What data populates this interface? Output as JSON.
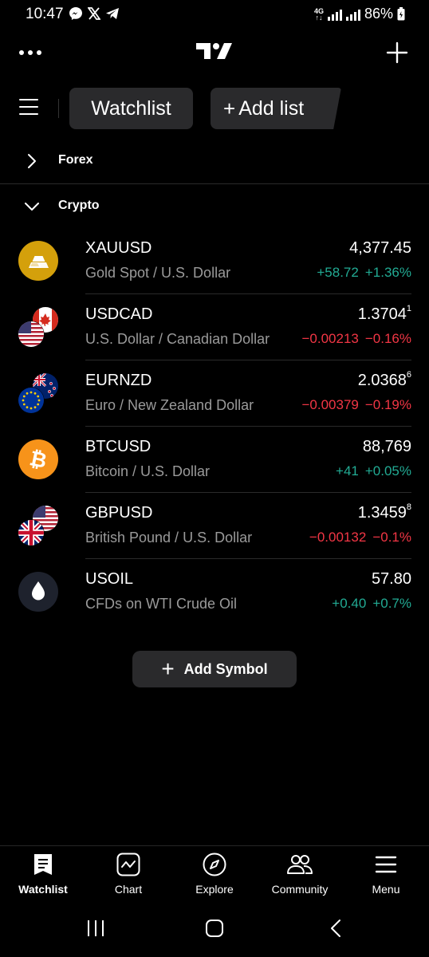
{
  "status_bar": {
    "time": "10:47",
    "network": "4G",
    "battery": "86%"
  },
  "tabs": {
    "watchlist": "Watchlist",
    "add_list": "Add list"
  },
  "sections": {
    "forex": "Forex",
    "crypto": "Crypto"
  },
  "symbols": [
    {
      "ticker": "XAUUSD",
      "name": "Gold Spot / U.S. Dollar",
      "price": "4,377.45",
      "price_sup": "",
      "change": "+58.72",
      "change_pct": "+1.36%",
      "direction": "up",
      "icon": "gold-bars-icon"
    },
    {
      "ticker": "USDCAD",
      "name": "U.S. Dollar / Canadian Dollar",
      "price": "1.3704",
      "price_sup": "1",
      "change": "−0.00213",
      "change_pct": "−0.16%",
      "direction": "down",
      "icon": "usd-cad-flags-icon"
    },
    {
      "ticker": "EURNZD",
      "name": "Euro / New Zealand Dollar",
      "price": "2.0368",
      "price_sup": "6",
      "change": "−0.00379",
      "change_pct": "−0.19%",
      "direction": "down",
      "icon": "eur-nzd-flags-icon"
    },
    {
      "ticker": "BTCUSD",
      "name": "Bitcoin / U.S. Dollar",
      "price": "88,769",
      "price_sup": "",
      "change": "+41",
      "change_pct": "+0.05%",
      "direction": "up",
      "icon": "bitcoin-icon"
    },
    {
      "ticker": "GBPUSD",
      "name": "British Pound / U.S. Dollar",
      "price": "1.3459",
      "price_sup": "8",
      "change": "−0.00132",
      "change_pct": "−0.1%",
      "direction": "down",
      "icon": "gbp-usd-flags-icon"
    },
    {
      "ticker": "USOIL",
      "name": "CFDs on WTI Crude Oil",
      "price": "57.80",
      "price_sup": "",
      "change": "+0.40",
      "change_pct": "+0.7%",
      "direction": "up",
      "icon": "oil-drop-icon"
    }
  ],
  "add_symbol": "Add Symbol",
  "bottom_nav": {
    "watchlist": "Watchlist",
    "chart": "Chart",
    "explore": "Explore",
    "community": "Community",
    "menu": "Menu"
  },
  "colors": {
    "background": "#000000",
    "positive": "#22ab94",
    "negative": "#f23645",
    "muted_text": "#9a9a9a",
    "surface": "#2a2a2c"
  }
}
